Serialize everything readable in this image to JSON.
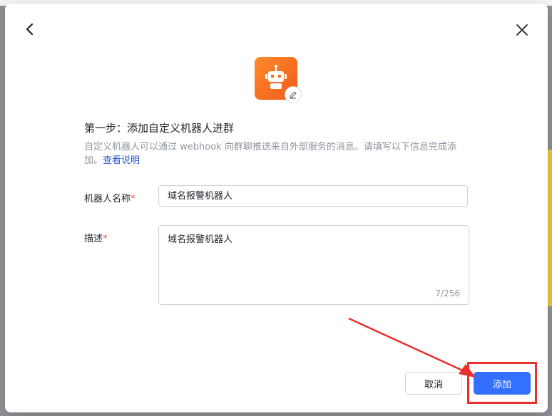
{
  "modal": {
    "step_title": "第一步：添加自定义机器人进群",
    "description": "自定义机器人可以通过 webhook 向群聊推送来自外部服务的消息。请填写以下信息完成添加。",
    "help_link": "查看说明",
    "avatar_icon": "robot-icon",
    "accent_color": "#3370ff",
    "avatar_color": "#f26b1d"
  },
  "form": {
    "name_label": "机器人名称",
    "name_value": "域名报警机器人",
    "desc_label": "描述",
    "desc_value": "域名报警机器人",
    "desc_counter": "7/256",
    "required_mark": "*"
  },
  "footer": {
    "cancel_label": "取消",
    "add_label": "添加"
  }
}
